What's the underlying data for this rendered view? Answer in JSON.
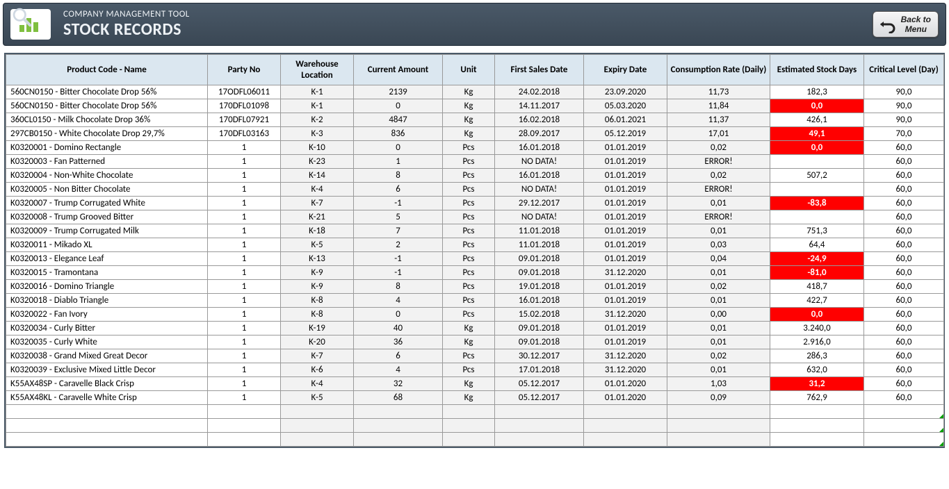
{
  "header": {
    "sup": "COMPANY MANAGEMENT TOOL",
    "title": "STOCK RECORDS",
    "back_line1": "Back to",
    "back_line2": "Menu"
  },
  "columns": [
    "Product Code - Name",
    "Party No",
    "Warehouse Location",
    "Current Amount",
    "Unit",
    "First Sales Date",
    "Expiry Date",
    "Consumption Rate (Daily)",
    "Estimated Stock Days",
    "Critical Level (Day)"
  ],
  "rows": [
    {
      "name": "560CN0150 - Bitter Chocolate Drop 56%",
      "party": "17ODFL06011",
      "wh": "K-1",
      "amt": "2139",
      "unit": "Kg",
      "fsd": "24.02.2018",
      "exp": "23.09.2020",
      "cr": "11,73",
      "esd": "182,3",
      "esd_red": false,
      "cl": "90,0"
    },
    {
      "name": "560CN0150 - Bitter Chocolate Drop 56%",
      "party": "170DFL01098",
      "wh": "K-1",
      "amt": "0",
      "unit": "Kg",
      "fsd": "14.11.2017",
      "exp": "05.03.2020",
      "cr": "11,84",
      "esd": "0,0",
      "esd_red": true,
      "cl": "90,0"
    },
    {
      "name": "360CL0150 - Milk Chocolate Drop 36%",
      "party": "170DFL07921",
      "wh": "K-2",
      "amt": "4847",
      "unit": "Kg",
      "fsd": "16.02.2018",
      "exp": "06.01.2021",
      "cr": "11,37",
      "esd": "426,1",
      "esd_red": false,
      "cl": "90,0"
    },
    {
      "name": "297CB0150 - White Chocolate Drop 29,7%",
      "party": "170DFL03163",
      "wh": "K-3",
      "amt": "836",
      "unit": "Kg",
      "fsd": "28.09.2017",
      "exp": "05.12.2019",
      "cr": "17,01",
      "esd": "49,1",
      "esd_red": true,
      "cl": "70,0"
    },
    {
      "name": "K0320001 - Domino Rectangle",
      "party": "1",
      "wh": "K-10",
      "amt": "0",
      "unit": "Pcs",
      "fsd": "16.01.2018",
      "exp": "01.01.2019",
      "cr": "0,02",
      "esd": "0,0",
      "esd_red": true,
      "cl": "60,0"
    },
    {
      "name": "K0320003 - Fan Patterned",
      "party": "1",
      "wh": "K-23",
      "amt": "1",
      "unit": "Pcs",
      "fsd": "NO DATA!",
      "exp": "01.01.2019",
      "cr": "ERROR!",
      "esd": "",
      "esd_red": false,
      "cl": "60,0"
    },
    {
      "name": "K0320004 - Non-White Chocolate",
      "party": "1",
      "wh": "K-14",
      "amt": "8",
      "unit": "Pcs",
      "fsd": "16.01.2018",
      "exp": "01.01.2019",
      "cr": "0,02",
      "esd": "507,2",
      "esd_red": false,
      "cl": "60,0"
    },
    {
      "name": "K0320005 - Non Bitter Chocolate",
      "party": "1",
      "wh": "K-4",
      "amt": "6",
      "unit": "Pcs",
      "fsd": "NO DATA!",
      "exp": "01.01.2019",
      "cr": "ERROR!",
      "esd": "",
      "esd_red": false,
      "cl": "60,0"
    },
    {
      "name": "K0320007 - Trump Corrugated White",
      "party": "1",
      "wh": "K-7",
      "amt": "-1",
      "unit": "Pcs",
      "fsd": "29.12.2017",
      "exp": "01.01.2019",
      "cr": "0,01",
      "esd": "-83,8",
      "esd_red": true,
      "cl": "60,0"
    },
    {
      "name": "K0320008 - Trump Grooved Bitter",
      "party": "1",
      "wh": "K-21",
      "amt": "5",
      "unit": "Pcs",
      "fsd": "NO DATA!",
      "exp": "01.01.2019",
      "cr": "ERROR!",
      "esd": "",
      "esd_red": false,
      "cl": "60,0"
    },
    {
      "name": "K0320009 - Trump Corrugated Milk",
      "party": "1",
      "wh": "K-18",
      "amt": "7",
      "unit": "Pcs",
      "fsd": "11.01.2018",
      "exp": "01.01.2019",
      "cr": "0,01",
      "esd": "751,3",
      "esd_red": false,
      "cl": "60,0"
    },
    {
      "name": "K0320011 - Mikado XL",
      "party": "1",
      "wh": "K-5",
      "amt": "2",
      "unit": "Pcs",
      "fsd": "11.01.2018",
      "exp": "01.01.2019",
      "cr": "0,03",
      "esd": "64,4",
      "esd_red": false,
      "cl": "60,0"
    },
    {
      "name": "K0320013 - Elegance Leaf",
      "party": "1",
      "wh": "K-13",
      "amt": "-1",
      "unit": "Pcs",
      "fsd": "09.01.2018",
      "exp": "01.01.2019",
      "cr": "0,04",
      "esd": "-24,9",
      "esd_red": true,
      "cl": "60,0"
    },
    {
      "name": "K0320015 - Tramontana",
      "party": "1",
      "wh": "K-9",
      "amt": "-1",
      "unit": "Pcs",
      "fsd": "09.01.2018",
      "exp": "31.12.2020",
      "cr": "0,01",
      "esd": "-81,0",
      "esd_red": true,
      "cl": "60,0"
    },
    {
      "name": "K0320016 - Domino Triangle",
      "party": "1",
      "wh": "K-9",
      "amt": "8",
      "unit": "Pcs",
      "fsd": "19.01.2018",
      "exp": "01.01.2019",
      "cr": "0,02",
      "esd": "418,7",
      "esd_red": false,
      "cl": "60,0"
    },
    {
      "name": "K0320018 - Diablo Triangle",
      "party": "1",
      "wh": "K-8",
      "amt": "4",
      "unit": "Pcs",
      "fsd": "16.01.2018",
      "exp": "01.01.2019",
      "cr": "0,01",
      "esd": "422,7",
      "esd_red": false,
      "cl": "60,0"
    },
    {
      "name": "K0320022 - Fan Ivory",
      "party": "1",
      "wh": "K-8",
      "amt": "0",
      "unit": "Pcs",
      "fsd": "15.02.2018",
      "exp": "31.12.2020",
      "cr": "0,00",
      "esd": "0,0",
      "esd_red": true,
      "cl": "60,0"
    },
    {
      "name": "K0320034 - Curly Bitter",
      "party": "1",
      "wh": "K-19",
      "amt": "40",
      "unit": "Kg",
      "fsd": "09.01.2018",
      "exp": "01.01.2019",
      "cr": "0,01",
      "esd": "3.240,0",
      "esd_red": false,
      "cl": "60,0"
    },
    {
      "name": "K0320035 - Curly White",
      "party": "1",
      "wh": "K-20",
      "amt": "36",
      "unit": "Kg",
      "fsd": "09.01.2018",
      "exp": "01.01.2019",
      "cr": "0,01",
      "esd": "2.916,0",
      "esd_red": false,
      "cl": "60,0"
    },
    {
      "name": "K0320038 - Grand Mixed Great Decor",
      "party": "1",
      "wh": "K-7",
      "amt": "6",
      "unit": "Pcs",
      "fsd": "30.12.2017",
      "exp": "31.12.2020",
      "cr": "0,02",
      "esd": "286,3",
      "esd_red": false,
      "cl": "60,0"
    },
    {
      "name": "K0320039 - Exclusive Mixed Little Decor",
      "party": "1",
      "wh": "K-6",
      "amt": "4",
      "unit": "Pcs",
      "fsd": "17.01.2018",
      "exp": "31.12.2020",
      "cr": "0,01",
      "esd": "632,0",
      "esd_red": false,
      "cl": "60,0"
    },
    {
      "name": "K55AX48SP - Caravelle Black Crisp",
      "party": "1",
      "wh": "K-4",
      "amt": "32",
      "unit": "Kg",
      "fsd": "05.12.2017",
      "exp": "01.01.2020",
      "cr": "1,03",
      "esd": "31,2",
      "esd_red": true,
      "cl": "60,0"
    },
    {
      "name": "K55AX48KL - Caravelle White Crisp",
      "party": "1",
      "wh": "K-5",
      "amt": "68",
      "unit": "Kg",
      "fsd": "05.12.2017",
      "exp": "01.01.2020",
      "cr": "0,09",
      "esd": "762,9",
      "esd_red": false,
      "cl": "60,0"
    }
  ],
  "empty_rows": 3
}
